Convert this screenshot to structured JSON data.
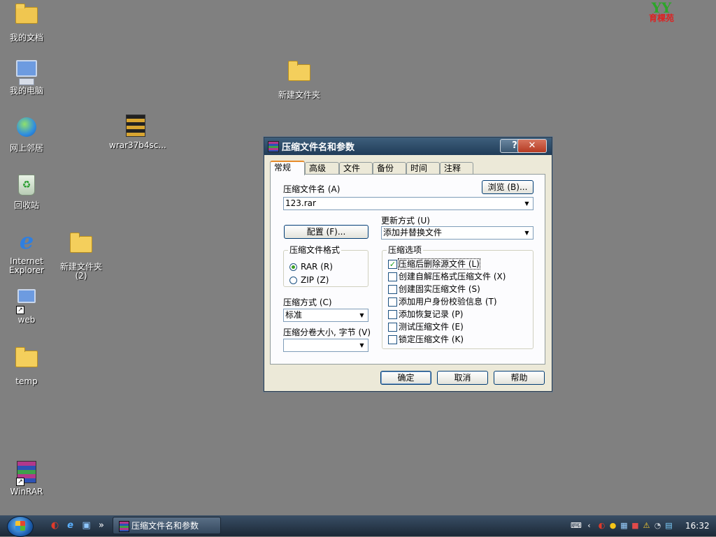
{
  "desktop": {
    "icons": [
      {
        "label": "我的文档"
      },
      {
        "label": "我的电脑"
      },
      {
        "label": "网上邻居"
      },
      {
        "label": "回收站"
      },
      {
        "label": "Internet Explorer"
      },
      {
        "label": "web"
      },
      {
        "label": "temp"
      },
      {
        "label": "WinRAR"
      },
      {
        "label": "wrar37b4sc..."
      },
      {
        "label": "新建文件夹"
      },
      {
        "label": "新建文件夹 (2)"
      }
    ],
    "logo_text": "育棵苑"
  },
  "dialog": {
    "title": "压缩文件名和参数",
    "help_btn": "?",
    "close_btn": "✕",
    "tabs": [
      "常规",
      "高级",
      "文件",
      "备份",
      "时间",
      "注释"
    ],
    "archive_name_label": "压缩文件名 (A)",
    "archive_name_value": "123.rar",
    "browse_button": "浏览 (B)...",
    "profile_button": "配置 (F)...",
    "update_mode_label": "更新方式 (U)",
    "update_mode_value": "添加并替换文件",
    "format_group": "压缩文件格式",
    "format_options": [
      "RAR (R)",
      "ZIP (Z)"
    ],
    "compression_label": "压缩方式 (C)",
    "compression_value": "标准",
    "volume_label": "压缩分卷大小, 字节 (V)",
    "volume_value": "",
    "options_group": "压缩选项",
    "options": [
      {
        "label": "压缩后删除源文件 (L)",
        "checked": true
      },
      {
        "label": "创建自解压格式压缩文件 (X)",
        "checked": false
      },
      {
        "label": "创建固实压缩文件 (S)",
        "checked": false
      },
      {
        "label": "添加用户身份校验信息 (T)",
        "checked": false
      },
      {
        "label": "添加恢复记录 (P)",
        "checked": false
      },
      {
        "label": "测试压缩文件 (E)",
        "checked": false
      },
      {
        "label": "锁定压缩文件 (K)",
        "checked": false
      }
    ],
    "ok": "确定",
    "cancel": "取消",
    "help": "帮助"
  },
  "taskbar": {
    "quicklaunch_more": "»",
    "task_button": "压缩文件名和参数",
    "clock": "16:32"
  }
}
